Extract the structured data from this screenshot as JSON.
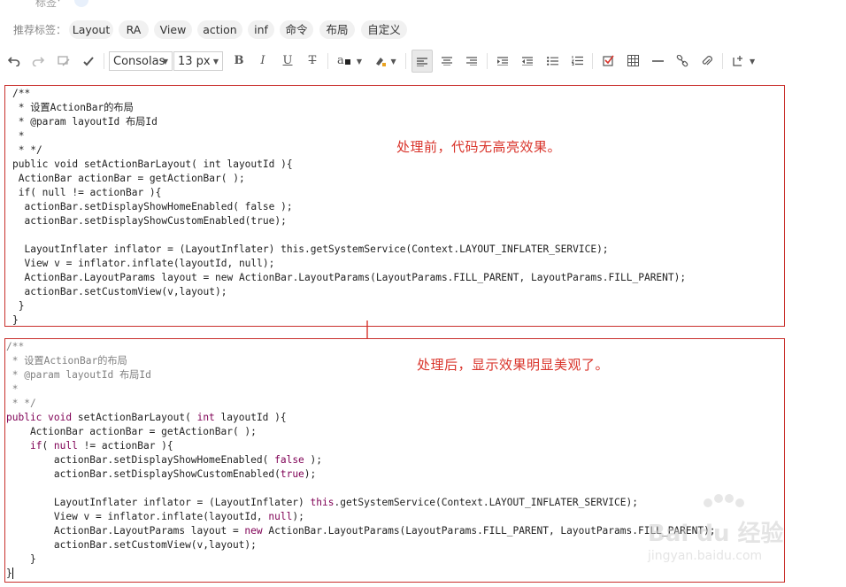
{
  "top": {
    "label": "标签",
    "chevron": "▾"
  },
  "tags": {
    "label": "推荐标签：",
    "items": [
      "Layout",
      "RA",
      "View",
      "action",
      "inf",
      "命令",
      "布局",
      "自定义"
    ]
  },
  "toolbar": {
    "font_family": "Consolas",
    "font_size": "13 px",
    "icons": [
      "undo-icon",
      "redo-icon",
      "clear-format-icon",
      "format-painter-icon",
      "bold-icon",
      "italic-icon",
      "underline-icon",
      "strikethrough-icon",
      "font-color-icon",
      "highlight-icon",
      "align-left-icon",
      "align-center-icon",
      "align-right-icon",
      "indent-icon",
      "outdent-icon",
      "bullet-list-icon",
      "numbered-list-icon",
      "checkbox-icon",
      "table-icon",
      "horizontal-rule-icon",
      "link-icon",
      "attachment-icon",
      "insert-icon"
    ],
    "bold": "B",
    "italic": "I",
    "underline": "U",
    "strike": "T",
    "font_color": "a",
    "accent": "#d9342b"
  },
  "code_before": [
    "/**",
    " * 设置ActionBar的布局",
    " * @param layoutId 布局Id",
    " *",
    " * */",
    "public void setActionBarLayout( int layoutId ){",
    " ActionBar actionBar = getActionBar( );",
    " if( null != actionBar ){",
    "  actionBar.setDisplayShowHomeEnabled( false );",
    "  actionBar.setDisplayShowCustomEnabled(true);",
    "",
    "  LayoutInflater inflator = (LayoutInflater) this.getSystemService(Context.LAYOUT_INFLATER_SERVICE);",
    "  View v = inflator.inflate(layoutId, null);",
    "  ActionBar.LayoutParams layout = new ActionBar.LayoutParams(LayoutParams.FILL_PARENT, LayoutParams.FILL_PARENT);",
    "  actionBar.setCustomView(v,layout);",
    " }",
    "}"
  ],
  "code_after": {
    "c1": "/**",
    "c2": " * 设置ActionBar的布局",
    "c3": " * @param layoutId 布局Id",
    "c4": " *",
    "c5": " * */",
    "l6a": "public",
    "l6b": " ",
    "l6c": "void",
    "l6d": " setActionBarLayout( ",
    "l6e": "int",
    "l6f": " layoutId ){",
    "l7": "    ActionBar actionBar = getActionBar( );",
    "l8a": "    ",
    "l8b": "if",
    "l8c": "( ",
    "l8d": "null",
    "l8e": " != actionBar ){",
    "l9a": "        actionBar.setDisplayShowHomeEnabled( ",
    "l9b": "false",
    "l9c": " );",
    "l10a": "        actionBar.setDisplayShowCustomEnabled(",
    "l10b": "true",
    "l10c": ");",
    "l11": "",
    "l12a": "        LayoutInflater inflator = (LayoutInflater) ",
    "l12b": "this",
    "l12c": ".getSystemService(Context.LAYOUT_INFLATER_SERVICE);",
    "l13a": "        View v = inflator.inflate(layoutId, ",
    "l13b": "null",
    "l13c": ");",
    "l14a": "        ActionBar.LayoutParams layout = ",
    "l14b": "new",
    "l14c": " ActionBar.LayoutParams(LayoutParams.FILL_PARENT, LayoutParams.FILL_PARENT);",
    "l15": "        actionBar.setCustomView(v,layout);",
    "l16": "    }",
    "l17": "}"
  },
  "notes": {
    "before": "处理前，代码无高亮效果。",
    "after": "处理后，显示效果明显美观了。"
  },
  "watermark": {
    "brand": "Bai du 经验",
    "url": "jingyan.baidu.com"
  },
  "colors": {
    "frame": "#c9302c",
    "comment": "#808080",
    "keyword": "#7f0055"
  }
}
